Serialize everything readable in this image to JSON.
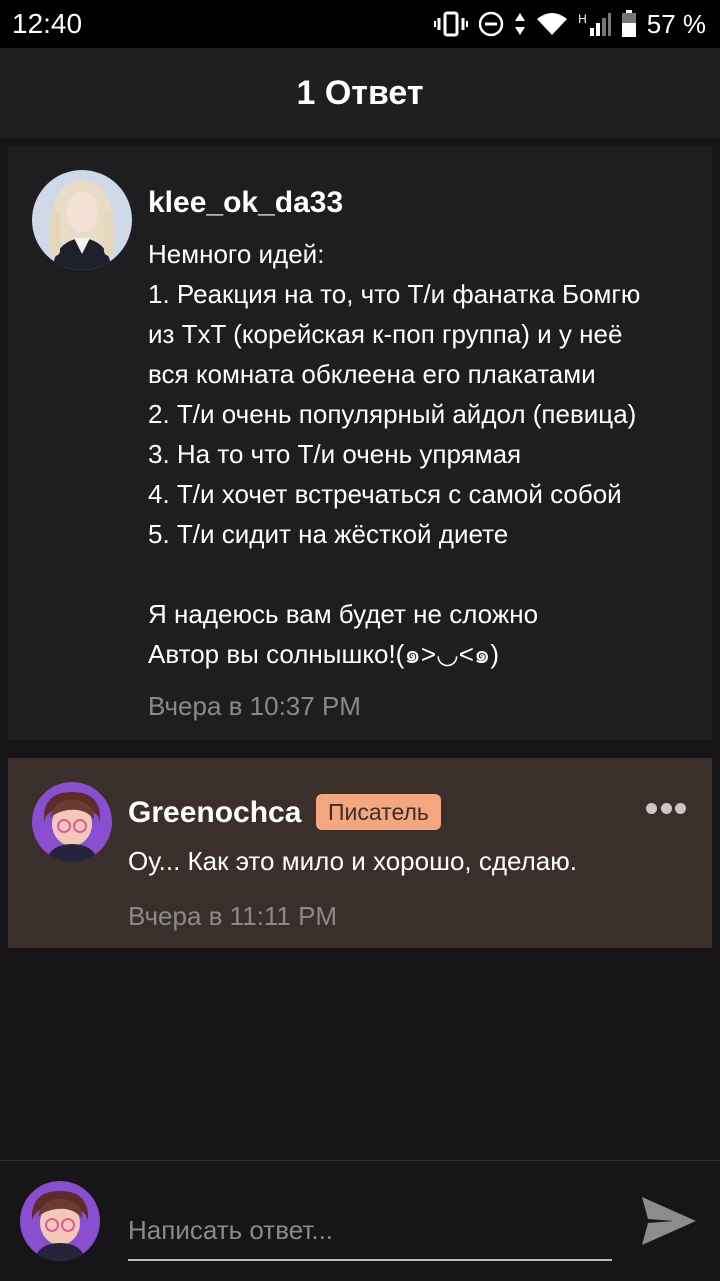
{
  "status_bar": {
    "time": "12:40",
    "network": "H",
    "battery": "57 %",
    "icons": [
      "vibrate-icon",
      "dnd-icon",
      "data-arrows-icon",
      "wifi-icon",
      "signal-icon",
      "battery-icon"
    ]
  },
  "header": {
    "title": "1 Ответ"
  },
  "original_comment": {
    "username": "klee_ok_da33",
    "lines": [
      "Немного идей:",
      "1. Реакция на то, что Т/и фанатка Бомгю",
      "из TxT (корейская к-поп группа) и у неё",
      "вся комната обклеена его плакатами",
      "2. Т/и очень популярный айдол (певица)",
      "3. На то что Т/и очень упрямая",
      "4. Т/и хочет встречаться с самой собой",
      "5. Т/и сидит на жёсткой диете",
      "",
      "Я надеюсь вам будет не сложно",
      "Автор вы солнышко!(๑>◡<๑)"
    ],
    "timestamp": "Вчера в 10:37 PM"
  },
  "reply": {
    "username": "Greenochca",
    "badge": "Писатель",
    "text": "Оу... Как это мило и хорошо, сделаю.",
    "timestamp": "Вчера в 11:11 PM"
  },
  "compose": {
    "placeholder": "Написать ответ..."
  },
  "colors": {
    "background": "#171517",
    "card": "#1e1e21",
    "reply_card": "#3a2f2b",
    "badge": "#f4a77e",
    "muted_text": "#8a8a8a"
  }
}
